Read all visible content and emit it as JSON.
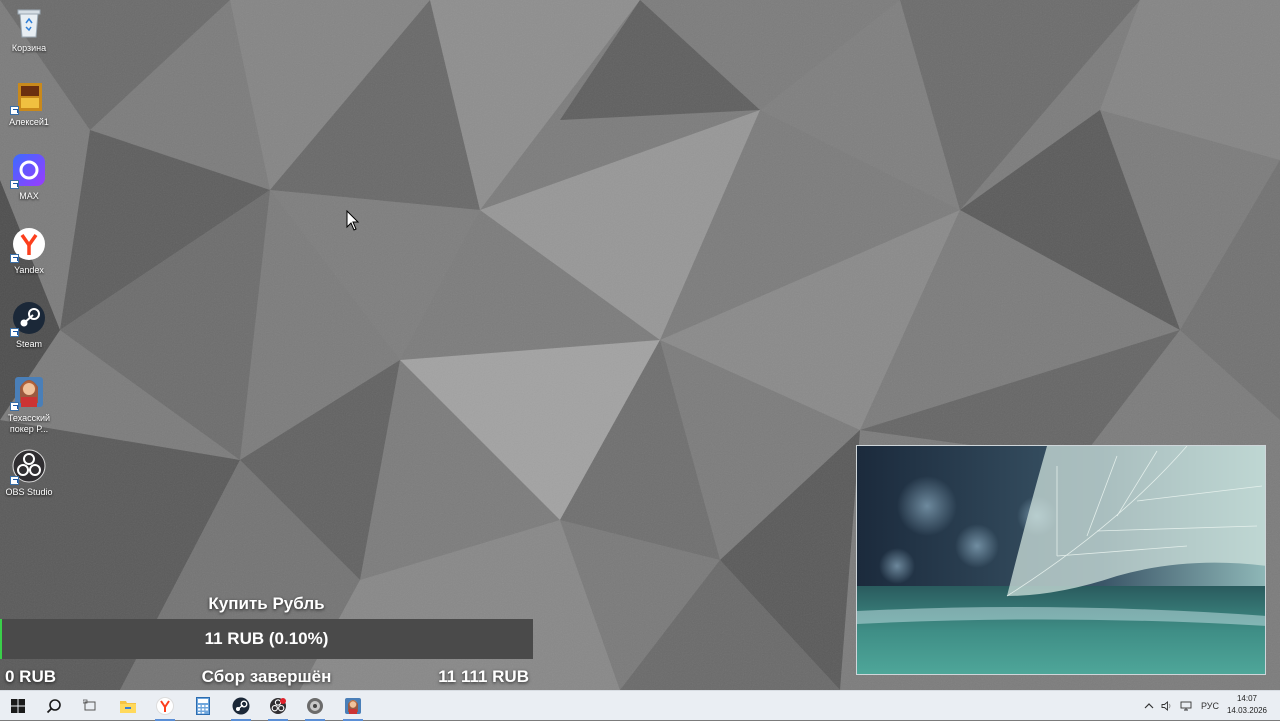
{
  "desktop": {
    "icons": [
      {
        "label": "Корзина",
        "icon": "recycle-bin-icon"
      },
      {
        "label": "Алексей1",
        "icon": "game-shortcut-icon"
      },
      {
        "label": "MAX",
        "icon": "max-messenger-icon"
      },
      {
        "label": "Yandex",
        "icon": "yandex-browser-icon"
      },
      {
        "label": "Steam",
        "icon": "steam-icon"
      },
      {
        "label": "Техасский покер Р...",
        "icon": "poker-game-icon"
      },
      {
        "label": "OBS Studio",
        "icon": "obs-studio-icon"
      }
    ]
  },
  "widget": {
    "title": "Купить Рубль",
    "progress_text": "11 RUB (0.10%)",
    "progress_fraction": 0.001,
    "min": "0 RUB",
    "status": "Сбор завершён",
    "max": "11 111 RUB",
    "fill_color": "#3ad04a"
  },
  "taskbar": {
    "buttons": [
      "start-icon",
      "search-icon",
      "task-view-icon",
      "file-explorer-icon",
      "yandex-browser-icon",
      "calculator-icon",
      "steam-icon",
      "obs-recording-icon",
      "app-icon",
      "poker-game-icon"
    ],
    "language": "РУС",
    "time": "14:07",
    "date": "14.03.2026"
  }
}
